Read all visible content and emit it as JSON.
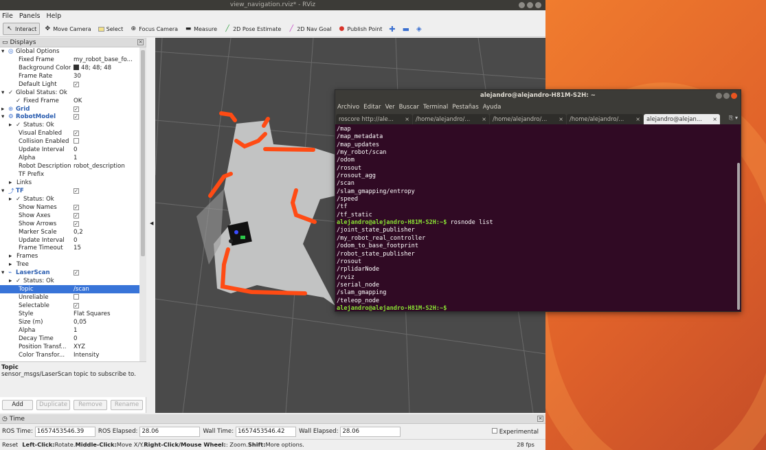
{
  "window": {
    "title": "view_navigation.rviz* - RViz"
  },
  "menu": [
    "File",
    "Panels",
    "Help"
  ],
  "toolbar": [
    {
      "label": "Interact",
      "icon": "cursor-icon",
      "active": true
    },
    {
      "label": "Move Camera",
      "icon": "move-camera-icon"
    },
    {
      "label": "Select",
      "icon": "select-icon"
    },
    {
      "label": "Focus Camera",
      "icon": "focus-camera-icon"
    },
    {
      "label": "Measure",
      "icon": "ruler-icon"
    },
    {
      "label": "2D Pose Estimate",
      "icon": "pose-arrow-icon"
    },
    {
      "label": "2D Nav Goal",
      "icon": "goal-arrow-icon"
    },
    {
      "label": "Publish Point",
      "icon": "pin-icon"
    }
  ],
  "displays": {
    "header": "Displays",
    "rows": [
      {
        "indent": 0,
        "exp": "▾",
        "icon": "◎",
        "key": "Global Options",
        "val": ""
      },
      {
        "indent": 2,
        "exp": "",
        "icon": "",
        "key": "Fixed Frame",
        "val": "my_robot_base_fo..."
      },
      {
        "indent": 2,
        "exp": "",
        "icon": "",
        "key": "Background Color",
        "val": "48; 48; 48",
        "swatch": true
      },
      {
        "indent": 2,
        "exp": "",
        "icon": "",
        "key": "Frame Rate",
        "val": "30"
      },
      {
        "indent": 2,
        "exp": "",
        "icon": "",
        "key": "Default Light",
        "val": "",
        "check": true
      },
      {
        "indent": 0,
        "exp": "▾",
        "icon": "✓",
        "key": "Global Status: Ok",
        "val": ""
      },
      {
        "indent": 1,
        "exp": "",
        "icon": "✓",
        "key": "Fixed Frame",
        "val": "OK"
      },
      {
        "indent": 0,
        "exp": "▸",
        "icon": "⊛",
        "key": "Grid",
        "val": "",
        "check": true,
        "blue": true
      },
      {
        "indent": 0,
        "exp": "▾",
        "icon": "⚙",
        "key": "RobotModel",
        "val": "",
        "check": true,
        "blue": true
      },
      {
        "indent": 1,
        "exp": "▸",
        "icon": "✓",
        "key": "Status: Ok",
        "val": ""
      },
      {
        "indent": 2,
        "exp": "",
        "icon": "",
        "key": "Visual Enabled",
        "val": "",
        "check": true
      },
      {
        "indent": 2,
        "exp": "",
        "icon": "",
        "key": "Collision Enabled",
        "val": "",
        "check": false
      },
      {
        "indent": 2,
        "exp": "",
        "icon": "",
        "key": "Update Interval",
        "val": "0"
      },
      {
        "indent": 2,
        "exp": "",
        "icon": "",
        "key": "Alpha",
        "val": "1"
      },
      {
        "indent": 2,
        "exp": "",
        "icon": "",
        "key": "Robot Description",
        "val": "robot_description"
      },
      {
        "indent": 2,
        "exp": "",
        "icon": "",
        "key": "TF Prefix",
        "val": ""
      },
      {
        "indent": 1,
        "exp": "▸",
        "icon": "",
        "key": "Links",
        "val": ""
      },
      {
        "indent": 0,
        "exp": "▾",
        "icon": "⤴",
        "key": "TF",
        "val": "",
        "check": true,
        "blue": true
      },
      {
        "indent": 1,
        "exp": "▸",
        "icon": "✓",
        "key": "Status: Ok",
        "val": ""
      },
      {
        "indent": 2,
        "exp": "",
        "icon": "",
        "key": "Show Names",
        "val": "",
        "check": true
      },
      {
        "indent": 2,
        "exp": "",
        "icon": "",
        "key": "Show Axes",
        "val": "",
        "check": true
      },
      {
        "indent": 2,
        "exp": "",
        "icon": "",
        "key": "Show Arrows",
        "val": "",
        "check": true
      },
      {
        "indent": 2,
        "exp": "",
        "icon": "",
        "key": "Marker Scale",
        "val": "0,2"
      },
      {
        "indent": 2,
        "exp": "",
        "icon": "",
        "key": "Update Interval",
        "val": "0"
      },
      {
        "indent": 2,
        "exp": "",
        "icon": "",
        "key": "Frame Timeout",
        "val": "15"
      },
      {
        "indent": 1,
        "exp": "▸",
        "icon": "",
        "key": "Frames",
        "val": ""
      },
      {
        "indent": 1,
        "exp": "▸",
        "icon": "",
        "key": "Tree",
        "val": ""
      },
      {
        "indent": 0,
        "exp": "▾",
        "icon": "⌁",
        "key": "LaserScan",
        "val": "",
        "check": true,
        "blue": true
      },
      {
        "indent": 1,
        "exp": "▸",
        "icon": "✓",
        "key": "Status: Ok",
        "val": ""
      },
      {
        "indent": 2,
        "exp": "",
        "icon": "",
        "key": "Topic",
        "val": "/scan",
        "sel": true
      },
      {
        "indent": 2,
        "exp": "",
        "icon": "",
        "key": "Unreliable",
        "val": "",
        "check": false
      },
      {
        "indent": 2,
        "exp": "",
        "icon": "",
        "key": "Selectable",
        "val": "",
        "check": true
      },
      {
        "indent": 2,
        "exp": "",
        "icon": "",
        "key": "Style",
        "val": "Flat Squares"
      },
      {
        "indent": 2,
        "exp": "",
        "icon": "",
        "key": "Size (m)",
        "val": "0,05"
      },
      {
        "indent": 2,
        "exp": "",
        "icon": "",
        "key": "Alpha",
        "val": "1"
      },
      {
        "indent": 2,
        "exp": "",
        "icon": "",
        "key": "Decay Time",
        "val": "0"
      },
      {
        "indent": 2,
        "exp": "",
        "icon": "",
        "key": "Position Transf...",
        "val": "XYZ"
      },
      {
        "indent": 2,
        "exp": "",
        "icon": "",
        "key": "Color Transfor...",
        "val": "Intensity"
      }
    ]
  },
  "description": {
    "title": "Topic",
    "text": "sensor_msgs/LaserScan topic to subscribe to."
  },
  "buttons": {
    "add": "Add",
    "duplicate": "Duplicate",
    "remove": "Remove",
    "rename": "Rename"
  },
  "time": {
    "header": "Time",
    "ros_time_label": "ROS Time:",
    "ros_time": "1657453546.39",
    "ros_elapsed_label": "ROS Elapsed:",
    "ros_elapsed": "28.06",
    "wall_time_label": "Wall Time:",
    "wall_time": "1657453546.42",
    "wall_elapsed_label": "Wall Elapsed:",
    "wall_elapsed": "28.06",
    "experimental": "Experimental"
  },
  "status": {
    "reset": "Reset",
    "hint_b1": "Left-Click:",
    "hint_t1": " Rotate. ",
    "hint_b2": "Middle-Click:",
    "hint_t2": " Move X/Y. ",
    "hint_b3": "Right-Click/Mouse Wheel:",
    "hint_t3": ": Zoom. ",
    "hint_b4": "Shift:",
    "hint_t4": " More options.",
    "fps": "28 fps"
  },
  "terminal": {
    "title": "alejandro@alejandro-H81M-S2H: ~",
    "menu": [
      "Archivo",
      "Editar",
      "Ver",
      "Buscar",
      "Terminal",
      "Pestañas",
      "Ayuda"
    ],
    "tabs": [
      "roscore http://ale...",
      "/home/alejandro/...",
      "/home/alejandro/...",
      "/home/alejandro/...",
      "alejandro@alejan..."
    ],
    "lines": [
      {
        "t": "/map"
      },
      {
        "t": "/map_metadata"
      },
      {
        "t": "/map_updates"
      },
      {
        "t": "/my_robot/scan"
      },
      {
        "t": "/odom"
      },
      {
        "t": "/rosout"
      },
      {
        "t": "/rosout_agg"
      },
      {
        "t": "/scan"
      },
      {
        "t": "/slam_gmapping/entropy"
      },
      {
        "t": "/speed"
      },
      {
        "t": "/tf"
      },
      {
        "t": "/tf_static"
      },
      {
        "p": "alejandro@alejandro-H81M-S2H:~$",
        "t": " rosnode list"
      },
      {
        "t": "/joint_state_publisher"
      },
      {
        "t": "/my_robot_real_controller"
      },
      {
        "t": "/odom_to_base_footprint"
      },
      {
        "t": "/robot_state_publisher"
      },
      {
        "t": "/rosout"
      },
      {
        "t": "/rplidarNode"
      },
      {
        "t": "/rviz"
      },
      {
        "t": "/serial_node"
      },
      {
        "t": "/slam_gmapping"
      },
      {
        "t": "/teleop_node"
      },
      {
        "p": "alejandro@alejandro-H81M-S2H:~$",
        "t": ""
      }
    ]
  },
  "colors": {
    "laser": "#ff4b14",
    "free_space": "#c2c3c3",
    "grid_bg": "#4a4a4a",
    "terminal_bg": "#300a24",
    "prompt": "#8ae234",
    "selection": "#3874d8"
  }
}
